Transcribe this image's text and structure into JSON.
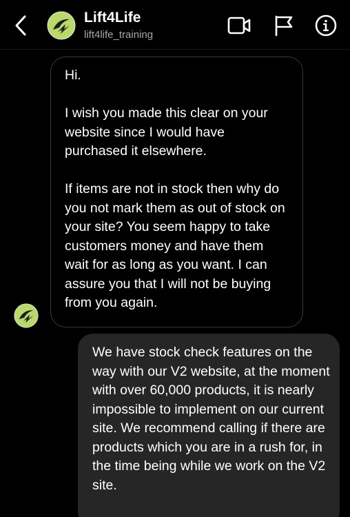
{
  "header": {
    "name": "Lift4Life",
    "handle": "lift4life_training"
  },
  "colors": {
    "background": "#000000",
    "incoming_border": "#3a3a3a",
    "outgoing_bubble": "#262626",
    "logo_green": "#b9d96a",
    "secondary_text": "#a8a8a8"
  },
  "icons": {
    "back": "chevron-left-icon",
    "video": "video-call-icon",
    "flag": "flag-icon",
    "info": "info-icon",
    "avatar": "lift4life-logo"
  },
  "messages": [
    {
      "direction": "incoming",
      "paragraphs": [
        "Hi.",
        "I wish you made this clear on your website since I would have purchased it elsewhere.",
        "If items are not in stock then why do you not mark them as out of stock on your site? You seem happy to take customers money and have them wait for as long as you want.  I can assure you that I will not be buying from you again."
      ]
    },
    {
      "direction": "outgoing",
      "paragraphs": [
        "We have stock check features on the way with our V2 website, at the moment with over 60,000 products, it is nearly impossible to implement on our current site. We recommend calling if there are products which you are in a rush for, in the time being while we work on the V2 site."
      ]
    }
  ]
}
